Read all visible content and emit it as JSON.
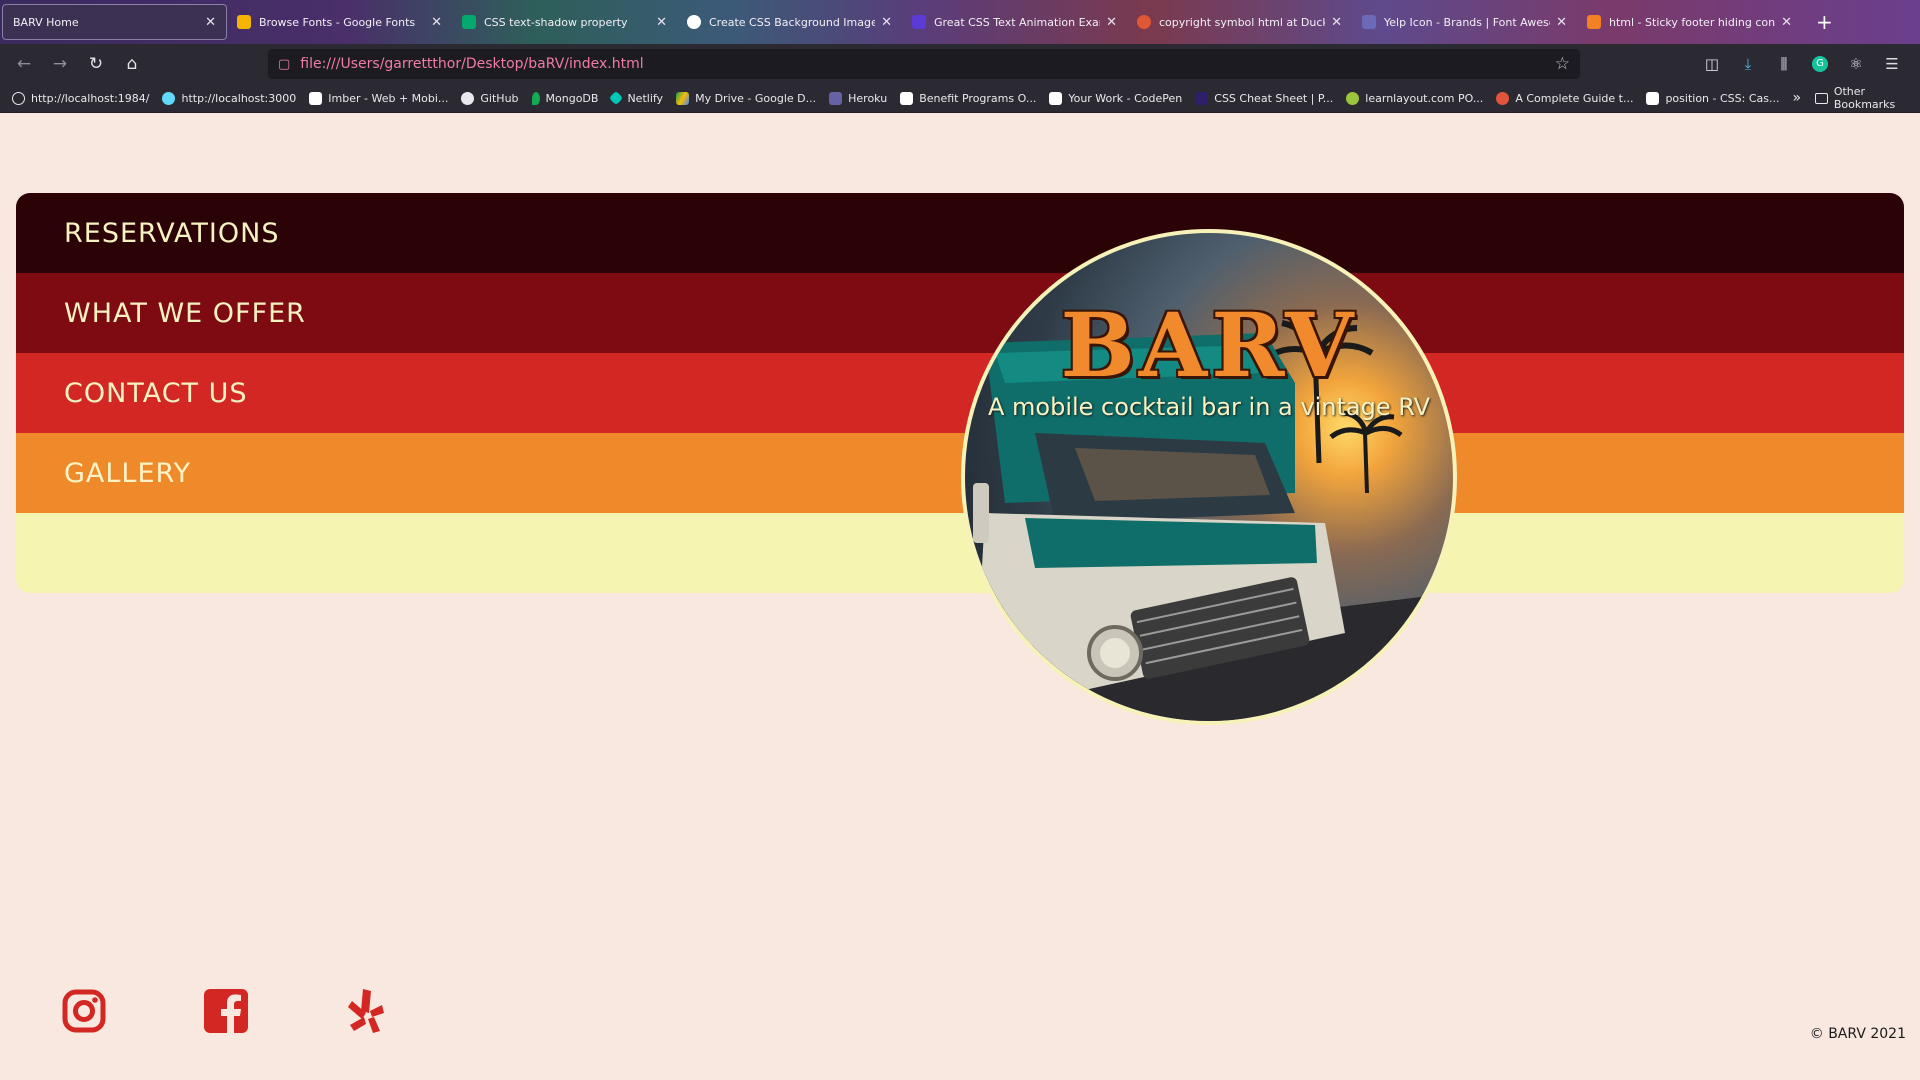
{
  "browser": {
    "tabs": [
      {
        "label": "BARV Home",
        "active": true,
        "favicon_color": "#3c3152"
      },
      {
        "label": "Browse Fonts - Google Fonts",
        "active": false,
        "favicon_color": "#f4b400"
      },
      {
        "label": "CSS text-shadow property",
        "active": false,
        "favicon_color": "#04aa6d"
      },
      {
        "label": "Create CSS Background Image",
        "active": false,
        "favicon_color": "#ffffff"
      },
      {
        "label": "Great CSS Text Animation Exam",
        "active": false,
        "favicon_color": "#5b3bd6"
      },
      {
        "label": "copyright symbol html at DuckD",
        "active": false,
        "favicon_color": "#de5833"
      },
      {
        "label": "Yelp Icon - Brands | Font Aweso",
        "active": false,
        "favicon_color": "#6c6ab8"
      },
      {
        "label": "html - Sticky footer hiding conte",
        "active": false,
        "favicon_color": "#f48024"
      }
    ],
    "url": "file:///Users/garrettthor/Desktop/baRV/index.html",
    "bookmarks": [
      {
        "label": "http://localhost:1984/",
        "color": "#e8e8ee"
      },
      {
        "label": "http://localhost:3000",
        "color": "#61dafb"
      },
      {
        "label": "Imber - Web + Mobi...",
        "color": "#ffffff"
      },
      {
        "label": "GitHub",
        "color": "#e8e8ee"
      },
      {
        "label": "MongoDB",
        "color": "#13aa52"
      },
      {
        "label": "Netlify",
        "color": "#00c7b7"
      },
      {
        "label": "My Drive - Google D...",
        "color": "#fbbc04"
      },
      {
        "label": "Heroku",
        "color": "#6762a6"
      },
      {
        "label": "Benefit Programs O...",
        "color": "#ffffff"
      },
      {
        "label": "Your Work - CodePen",
        "color": "#ffffff"
      },
      {
        "label": "CSS Cheat Sheet | P...",
        "color": "#2f1f6b"
      },
      {
        "label": "learnlayout.com PO...",
        "color": "#9bc53d"
      },
      {
        "label": "A Complete Guide t...",
        "color": "#e2543b"
      },
      {
        "label": "position - CSS: Cas...",
        "color": "#ffffff"
      }
    ],
    "other_bookmarks": "Other Bookmarks"
  },
  "nav": {
    "items": [
      "RESERVATIONS",
      "WHAT WE OFFER",
      "CONTACT US",
      "GALLERY"
    ]
  },
  "logo": {
    "brand": "BARV",
    "tagline": "A mobile cocktail bar in a vintage RV"
  },
  "social": {
    "icons": [
      "instagram-icon",
      "facebook-icon",
      "yelp-icon"
    ],
    "color": "#d32724"
  },
  "footer": {
    "copyright": "© BARV 2021"
  }
}
